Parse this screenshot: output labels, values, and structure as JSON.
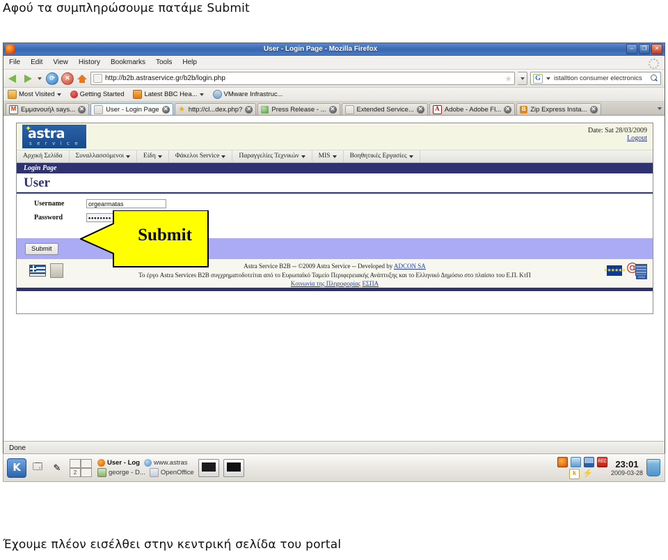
{
  "slide": {
    "caption_top": "Αφού τα συμπληρώσουμε πατάμε Submit",
    "caption_bottom": "Έχουμε πλέον εισέλθει στην κεντρική σελίδα του portal"
  },
  "browser": {
    "title": "User - Login Page - Mozilla Firefox",
    "window_buttons": {
      "minimize": "–",
      "maximize": "❐",
      "close": "✕"
    },
    "menus": [
      "File",
      "Edit",
      "View",
      "History",
      "Bookmarks",
      "Tools",
      "Help"
    ],
    "url": "http://b2b.astraservice.gr/b2b/login.php",
    "search_value": "istalltion consumer electronics",
    "bookmarks": [
      {
        "label": "Most Visited",
        "icon": "folder-icon",
        "caret": true
      },
      {
        "label": "Getting Started",
        "icon": "getting-started-icon",
        "caret": false
      },
      {
        "label": "Latest BBC Hea...",
        "icon": "rss-icon",
        "caret": true
      },
      {
        "label": "VMware Infrastruc...",
        "icon": "vmware-icon",
        "caret": false
      }
    ],
    "tabs": [
      {
        "label": "Εμμανουήλ says...",
        "favicon": "gmail-icon",
        "active": false
      },
      {
        "label": "User - Login Page",
        "favicon": "page-icon",
        "active": true
      },
      {
        "label": "http://cl...dex.php?",
        "favicon": "star-icon",
        "active": false
      },
      {
        "label": "Press Release - ...",
        "favicon": "globe-icon",
        "active": false
      },
      {
        "label": "Extended Service...",
        "favicon": "page-icon",
        "active": false
      },
      {
        "label": "Adobe - Adobe Fl...",
        "favicon": "adobe-icon",
        "active": false
      },
      {
        "label": "Zip Express Insta...",
        "favicon": "zip-icon",
        "active": false
      }
    ],
    "status": "Done"
  },
  "site": {
    "logo": {
      "name": "astra",
      "tagline": "s e r v i c e"
    },
    "date_label": "Date: Sat 28/03/2009",
    "logout_label": "Logout",
    "menu": [
      {
        "label": "Αρχική Σελίδα",
        "caret": false
      },
      {
        "label": "Συναλλασσόμενοι",
        "caret": true
      },
      {
        "label": "Είδη",
        "caret": true
      },
      {
        "label": "Φάκελοι Service",
        "caret": true
      },
      {
        "label": "Παραγγελίες Τεχνικών",
        "caret": true
      },
      {
        "label": "MIS",
        "caret": true
      },
      {
        "label": "Βοηθητικές Εργασίες",
        "caret": true
      }
    ],
    "breadcrumb": "Login Page",
    "heading": "User",
    "form": {
      "username_label": "Username",
      "username_value": "orgearmatas",
      "password_label": "Password",
      "password_value": "••••••••",
      "submit_label": "Submit"
    },
    "footer": {
      "line1": "Astra Service B2B -- ©2009 Astra Service -- Developed by ",
      "line1_link": "ADCON SA",
      "line2": "Το έργο Astra Services B2B συγχρηματοδοτείται από το Ευρωπαϊκό Ταμείο Περιφερειακής Ανάπτυξης και το Ελληνικό Δημόσιο στο πλαίσιο του Ε.Π. ΚτΠ",
      "line3_link1": "Κοινωνία της Πληροφορίας",
      "line3_link2": "ΕΣΠΑ"
    }
  },
  "annotation": {
    "label": "Submit",
    "color": "#ffff00"
  },
  "taskbar": {
    "kmenu_label": "K",
    "pager": {
      "desktop_current": "2"
    },
    "tasks": [
      {
        "label": "User - Log",
        "icon": "firefox-icon",
        "active": true
      },
      {
        "label": "www.astras",
        "icon": "globe-icon",
        "active": false
      },
      {
        "label": "george - D...",
        "icon": "image-icon",
        "active": false
      },
      {
        "label": "OpenOffice",
        "icon": "openoffice-icon",
        "active": false
      }
    ],
    "clock_time": "23:01",
    "clock_date": "2009-03-28",
    "tray": [
      "firefox-icon",
      "volume-icon",
      "signal-icon",
      "recorder-icon",
      "klipper-icon",
      "power-icon"
    ]
  },
  "colors": {
    "titlebar": "#3667b2",
    "site_accent": "#2e3270",
    "submit_bar": "#aaaaf5",
    "desktop": "#676d5c",
    "annotation_yellow": "#ffff00"
  }
}
